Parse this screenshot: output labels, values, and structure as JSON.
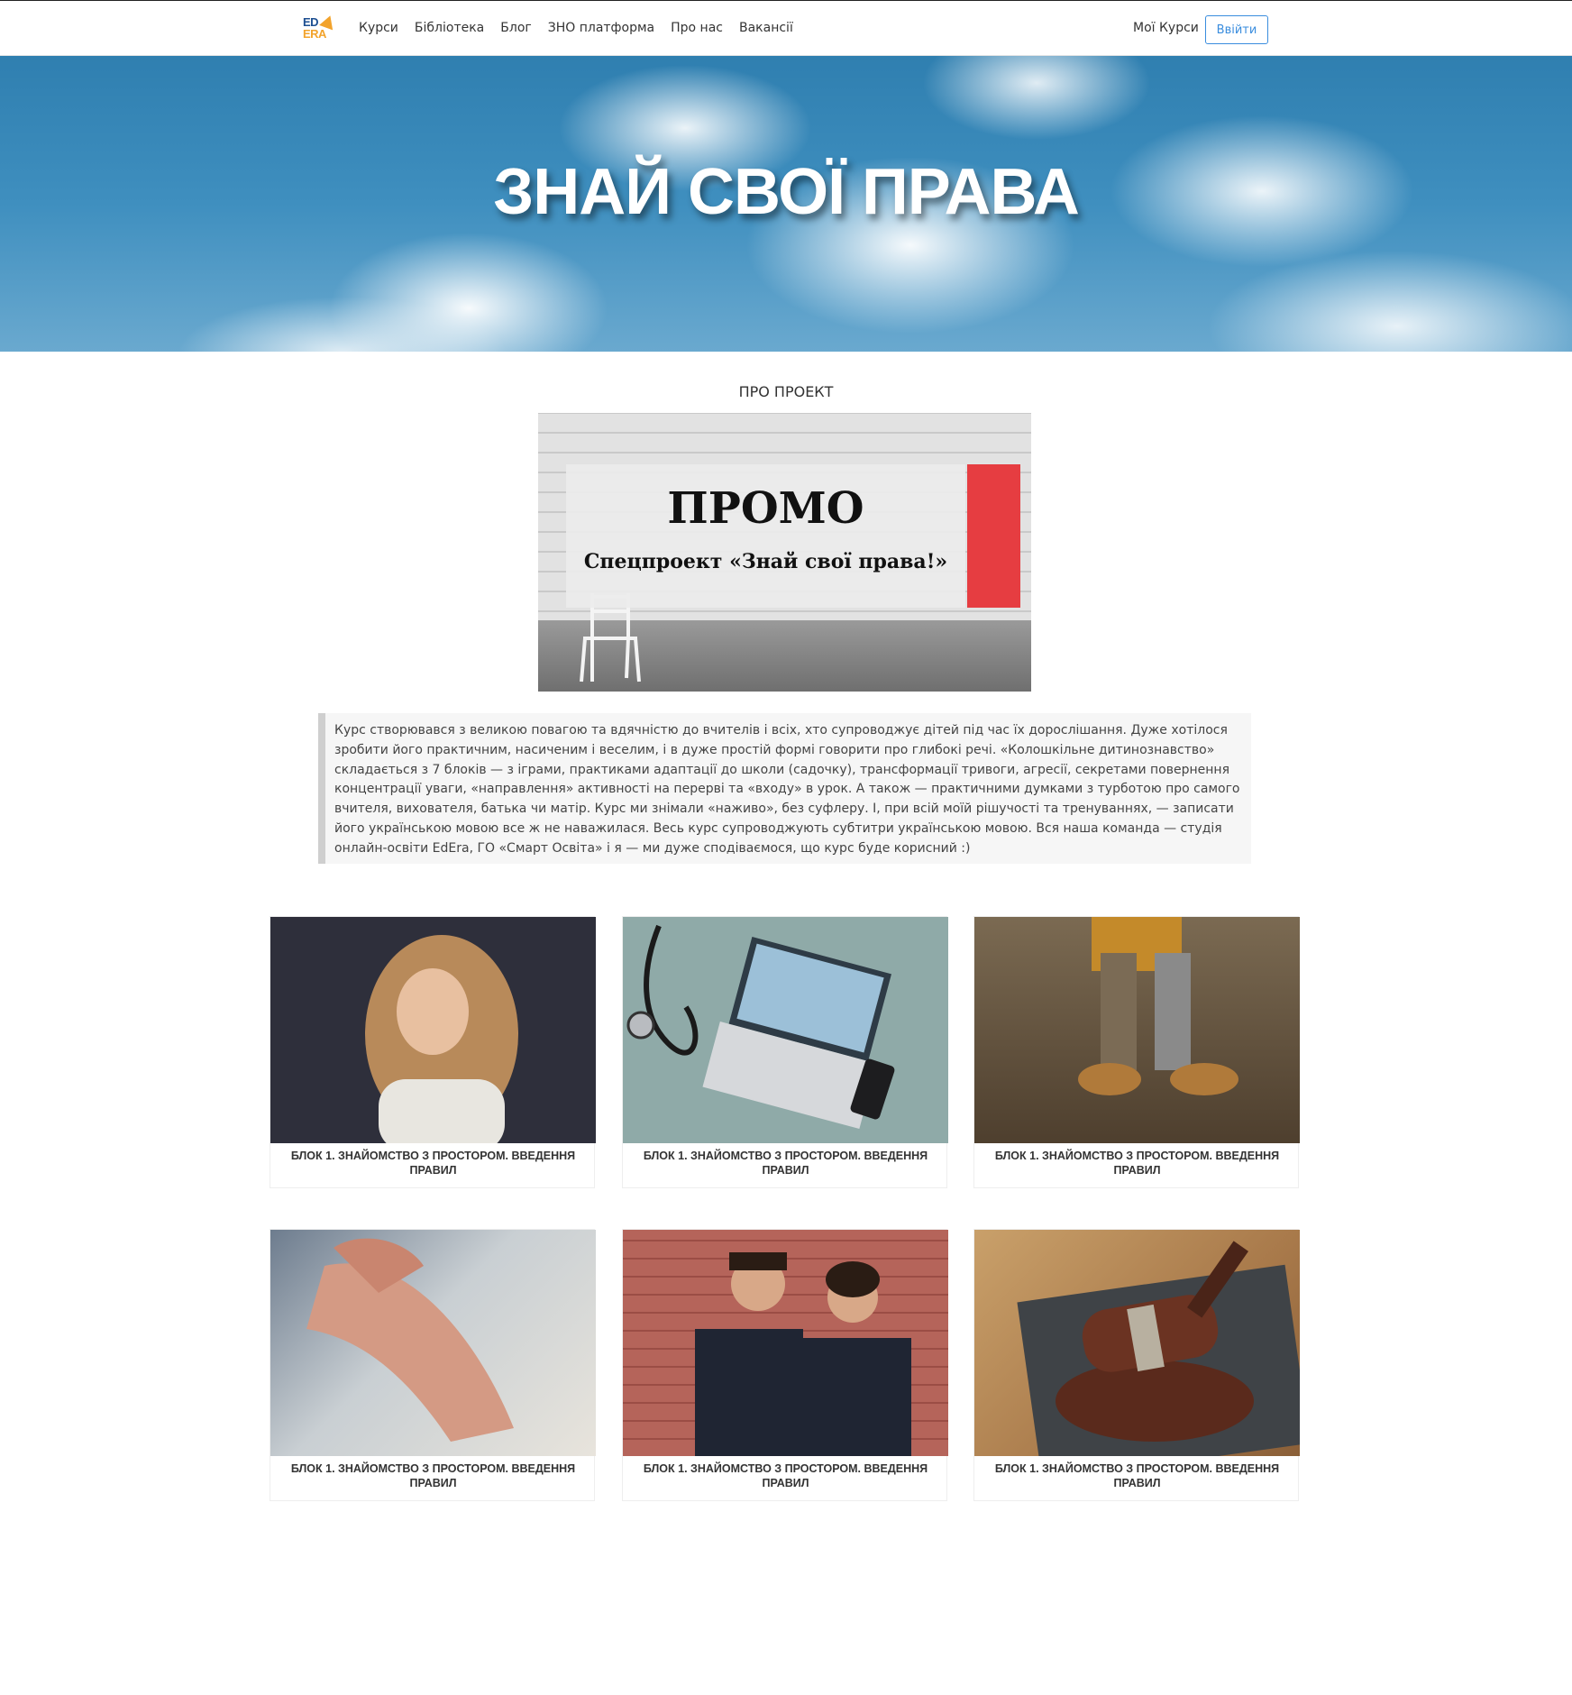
{
  "header": {
    "logo_top": "ED",
    "logo_bottom": "ERA",
    "nav": [
      "Курси",
      "Бібліотека",
      "Блог",
      "ЗНО платформа",
      "Про нас",
      "Вакансії"
    ],
    "my_courses": "Мої Курси",
    "login": "Ввійти"
  },
  "hero": {
    "title": "ЗНАЙ СВОЇ ПРАВА"
  },
  "about": {
    "label": "ПРО ПРОЕКТ",
    "promo_title": "ПРОМО",
    "promo_subtitle": "Спецпроект «Знай свої права!»",
    "description": "Курс створювався з великою повагою та вдячністю до вчителів і всіх, хто супроводжує дітей під час їх дорослішання. Дуже хотілося зробити його практичним, насиченим і веселим, і в дуже простій формі говорити про глибокі речі. «Колошкільне дитинознавство» складається з 7 блоків — з іграми, практиками адаптації до школи (садочку), трансформації тривоги, агресії, секретами повернення концентрації уваги, «направлення» активності на перерві та «входу» в урок. А також — практичними думками з турботою про самого вчителя, вихователя, батька чи матір. Курс ми знімали «наживо», без суфлеру. І, при всій моїй рішучості та тренуваннях, — записати його українською мовою все ж не наважилася. Весь курс супроводжують субтитри українською мовою. Вся наша команда — студія онлайн-освіти EdEra, ГО «Смарт Освіта» і я — ми дуже сподіваємося, що курс буде корисний :)"
  },
  "blocks": [
    {
      "caption": "БЛОК 1. ЗНАЙОМСТВО З ПРОСТОРОМ. ВВЕДЕННЯ ПРАВИЛ"
    },
    {
      "caption": "БЛОК 1. ЗНАЙОМСТВО З ПРОСТОРОМ. ВВЕДЕННЯ ПРАВИЛ"
    },
    {
      "caption": "БЛОК 1. ЗНАЙОМСТВО З ПРОСТОРОМ. ВВЕДЕННЯ ПРАВИЛ"
    },
    {
      "caption": "БЛОК 1. ЗНАЙОМСТВО З ПРОСТОРОМ. ВВЕДЕННЯ ПРАВИЛ"
    },
    {
      "caption": "БЛОК 1. ЗНАЙОМСТВО З ПРОСТОРОМ. ВВЕДЕННЯ ПРАВИЛ"
    },
    {
      "caption": "БЛОК 1. ЗНАЙОМСТВО З ПРОСТОРОМ. ВВЕДЕННЯ ПРАВИЛ"
    }
  ],
  "colors": {
    "accent": "#3a8dde",
    "promo_red": "#e63d41",
    "logo_blue": "#1d4f91",
    "logo_orange": "#f2a32c"
  }
}
